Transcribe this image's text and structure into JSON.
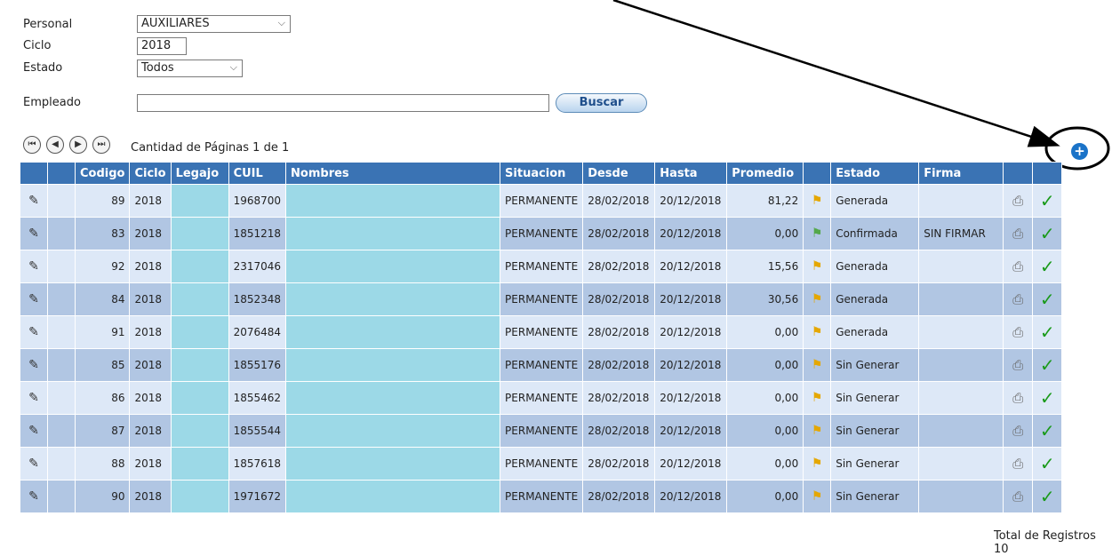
{
  "form": {
    "personal_label": "Personal",
    "personal_value": "AUXILIARES",
    "ciclo_label": "Ciclo",
    "ciclo_value": "2018",
    "estado_label": "Estado",
    "estado_value": "Todos",
    "empleado_label": "Empleado",
    "empleado_value": "",
    "buscar_label": "Buscar"
  },
  "pager": {
    "first": "⏮",
    "prev": "◀",
    "next": "▶",
    "last": "⏭",
    "text": "Cantidad de Páginas  1  de  1"
  },
  "add_icon": "+",
  "table": {
    "columns": [
      "",
      "",
      "Codigo",
      "Ciclo",
      "Legajo",
      "CUIL",
      "Nombres",
      "Situacion",
      "Desde",
      "Hasta",
      "Promedio",
      "",
      "Estado",
      "Firma",
      "",
      ""
    ],
    "rows": [
      {
        "codigo": "89",
        "ciclo": "2018",
        "cuil": "1968700",
        "situacion": "PERMANENTE",
        "desde": "28/02/2018",
        "hasta": "20/12/2018",
        "promedio": "81,22",
        "flag": "yellow",
        "estado": "Generada",
        "firma": ""
      },
      {
        "codigo": "83",
        "ciclo": "2018",
        "cuil": "1851218",
        "situacion": "PERMANENTE",
        "desde": "28/02/2018",
        "hasta": "20/12/2018",
        "promedio": "0,00",
        "flag": "green",
        "estado": "Confirmada",
        "firma": "SIN FIRMAR"
      },
      {
        "codigo": "92",
        "ciclo": "2018",
        "cuil": "2317046",
        "situacion": "PERMANENTE",
        "desde": "28/02/2018",
        "hasta": "20/12/2018",
        "promedio": "15,56",
        "flag": "yellow",
        "estado": "Generada",
        "firma": ""
      },
      {
        "codigo": "84",
        "ciclo": "2018",
        "cuil": "1852348",
        "situacion": "PERMANENTE",
        "desde": "28/02/2018",
        "hasta": "20/12/2018",
        "promedio": "30,56",
        "flag": "yellow",
        "estado": "Generada",
        "firma": ""
      },
      {
        "codigo": "91",
        "ciclo": "2018",
        "cuil": "2076484",
        "situacion": "PERMANENTE",
        "desde": "28/02/2018",
        "hasta": "20/12/2018",
        "promedio": "0,00",
        "flag": "yellow",
        "estado": "Generada",
        "firma": ""
      },
      {
        "codigo": "85",
        "ciclo": "2018",
        "cuil": "1855176",
        "situacion": "PERMANENTE",
        "desde": "28/02/2018",
        "hasta": "20/12/2018",
        "promedio": "0,00",
        "flag": "yellow",
        "estado": "Sin Generar",
        "firma": ""
      },
      {
        "codigo": "86",
        "ciclo": "2018",
        "cuil": "1855462",
        "situacion": "PERMANENTE",
        "desde": "28/02/2018",
        "hasta": "20/12/2018",
        "promedio": "0,00",
        "flag": "yellow",
        "estado": "Sin Generar",
        "firma": ""
      },
      {
        "codigo": "87",
        "ciclo": "2018",
        "cuil": "1855544",
        "situacion": "PERMANENTE",
        "desde": "28/02/2018",
        "hasta": "20/12/2018",
        "promedio": "0,00",
        "flag": "yellow",
        "estado": "Sin Generar",
        "firma": ""
      },
      {
        "codigo": "88",
        "ciclo": "2018",
        "cuil": "1857618",
        "situacion": "PERMANENTE",
        "desde": "28/02/2018",
        "hasta": "20/12/2018",
        "promedio": "0,00",
        "flag": "yellow",
        "estado": "Sin Generar",
        "firma": ""
      },
      {
        "codigo": "90",
        "ciclo": "2018",
        "cuil": "1971672",
        "situacion": "PERMANENTE",
        "desde": "28/02/2018",
        "hasta": "20/12/2018",
        "promedio": "0,00",
        "flag": "yellow",
        "estado": "Sin Generar",
        "firma": ""
      }
    ]
  },
  "footer": {
    "total_label": "Total de Registros",
    "total_value": "10"
  }
}
